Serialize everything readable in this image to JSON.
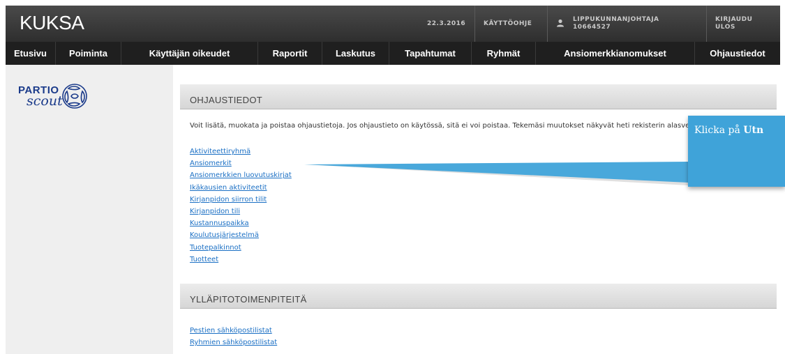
{
  "header": {
    "app_title": "KUKSA",
    "date": "22.3.2016",
    "help": "KÄYTTÖOHJE",
    "user_role": "LIPPUKUNNANJOHTAJA",
    "user_id": "10664527",
    "logout_line1": "KIRJAUDU",
    "logout_line2": "ULOS"
  },
  "nav": {
    "items": [
      {
        "label": "Etusivu"
      },
      {
        "label": "Poiminta"
      },
      {
        "label": "Käyttäjän oikeudet"
      },
      {
        "label": "Raportit"
      },
      {
        "label": "Laskutus"
      },
      {
        "label": "Tapahtumat"
      },
      {
        "label": "Ryhmät"
      },
      {
        "label": "Ansiomerkkianomukset"
      },
      {
        "label": "Ohjaustiedot"
      }
    ]
  },
  "logo": {
    "line1": "PARTIO",
    "line2": "scout"
  },
  "section1": {
    "title": "OHJAUSTIEDOT",
    "description": "Voit lisätä, muokata ja poistaa ohjaustietoja. Jos ohjaustieto on käytössä, sitä ei voi poistaa. Tekemäsi muutokset näkyvät heti rekisterin alasvetovalikoissa.",
    "links": [
      "Aktiviteettiryhmä",
      "Ansiomerkit",
      "Ansiomerkkien luovutuskirjat",
      "Ikäkausien aktiviteetit",
      "Kirjanpidon siirron tilit",
      "Kirjanpidon tili",
      "Kustannuspaikka",
      "Koulutusjärjestelmä",
      "Tuotepalkinnot",
      "Tuotteet"
    ]
  },
  "section2": {
    "title": "YLLÄPITOTOIMENPITEITÄ",
    "links": [
      "Pestien sähköpostilistat",
      "Ryhmien sähköpostilistat"
    ]
  },
  "tooltip": {
    "prefix": "Klicka på ",
    "bold": "Utn"
  },
  "colors": {
    "link": "#1a6fc4",
    "tooltip": "#3fa3d9",
    "nav_bg": "#1f1f1f",
    "sidebar_bg": "#efefef"
  }
}
